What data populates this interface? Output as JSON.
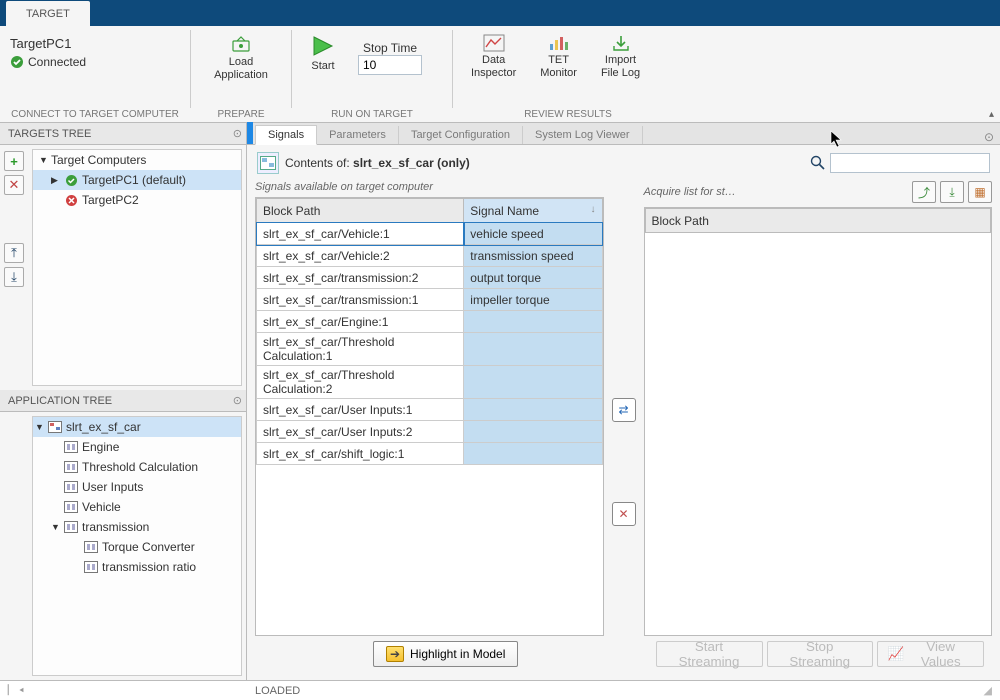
{
  "title_tab": "TARGET",
  "ribbon": {
    "target_name": "TargetPC1",
    "status": "Connected",
    "group1_label": "CONNECT TO TARGET COMPUTER",
    "load_app_label": "Load Application",
    "group2_label": "PREPARE",
    "start_label": "Start",
    "stop_time_label": "Stop Time",
    "stop_time_value": "10",
    "group3_label": "RUN ON TARGET",
    "data_inspector_label": "Data\nInspector",
    "tet_monitor_label": "TET\nMonitor",
    "import_log_label": "Import\nFile Log",
    "group4_label": "REVIEW RESULTS"
  },
  "targets_tree_header": "TARGETS TREE",
  "targets_root": "Target Computers",
  "target1": "TargetPC1 (default)",
  "target2": "TargetPC2",
  "app_tree_header": "APPLICATION TREE",
  "app_root": "slrt_ex_sf_car",
  "app_nodes": {
    "engine": "Engine",
    "threshold": "Threshold Calculation",
    "user_inputs": "User Inputs",
    "vehicle": "Vehicle",
    "transmission": "transmission",
    "torque_conv": "Torque Converter",
    "trans_ratio": "transmission ratio"
  },
  "main_tabs": {
    "signals": "Signals",
    "parameters": "Parameters",
    "target_config": "Target Configuration",
    "syslog": "System Log Viewer"
  },
  "contents_prefix": "Contents of: ",
  "contents_model": "slrt_ex_sf_car (only)",
  "signals_available_label": "Signals available on target computer",
  "acquire_label": "Acquire list for st…",
  "table_headers": {
    "block_path": "Block Path",
    "signal_name": "Signal Name"
  },
  "signals": [
    {
      "path": "slrt_ex_sf_car/Vehicle:1",
      "name": "vehicle speed"
    },
    {
      "path": "slrt_ex_sf_car/Vehicle:2",
      "name": "transmission speed"
    },
    {
      "path": "slrt_ex_sf_car/transmission:2",
      "name": "output torque"
    },
    {
      "path": "slrt_ex_sf_car/transmission:1",
      "name": "impeller torque"
    },
    {
      "path": "slrt_ex_sf_car/Engine:1",
      "name": ""
    },
    {
      "path": "slrt_ex_sf_car/Threshold Calculation:1",
      "name": ""
    },
    {
      "path": "slrt_ex_sf_car/Threshold Calculation:2",
      "name": ""
    },
    {
      "path": "slrt_ex_sf_car/User Inputs:1",
      "name": ""
    },
    {
      "path": "slrt_ex_sf_car/User Inputs:2",
      "name": ""
    },
    {
      "path": "slrt_ex_sf_car/shift_logic:1",
      "name": ""
    }
  ],
  "acquire_header": "Block Path",
  "highlight_label": "Highlight in Model",
  "start_streaming": "Start Streaming",
  "stop_streaming": "Stop Streaming",
  "view_values": "View Values",
  "status": "LOADED"
}
